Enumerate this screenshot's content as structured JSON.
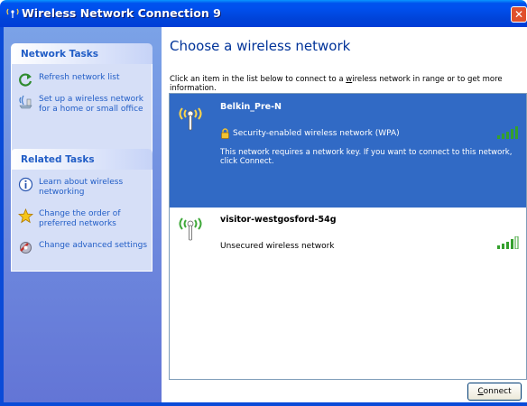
{
  "window": {
    "title": "Wireless Network Connection 9",
    "close_glyph": "✕"
  },
  "sidebar": {
    "network_tasks": {
      "title": "Network Tasks",
      "items": [
        {
          "label": "Refresh network list",
          "icon": "refresh-icon"
        },
        {
          "label": "Set up a wireless network for a home or small office",
          "icon": "setup-wireless-icon"
        }
      ]
    },
    "related_tasks": {
      "title": "Related Tasks",
      "items": [
        {
          "label": "Learn about wireless networking",
          "icon": "info-icon"
        },
        {
          "label": "Change the order of preferred networks",
          "icon": "star-icon"
        },
        {
          "label": "Change advanced settings",
          "icon": "settings-icon"
        }
      ]
    }
  },
  "main": {
    "heading": "Choose a wireless network",
    "instructions": {
      "before": "Click an item in the list below to connect to a ",
      "underlined_char": "w",
      "after": "ireless network in range or to get more information."
    },
    "networks": [
      {
        "name": "Belkin_Pre-N",
        "security": "Security-enabled wireless network (WPA)",
        "description": "This network requires a network key. If you want to connect to this network, click Connect.",
        "selected": true,
        "signal_bars": 5
      },
      {
        "name": "visitor-westgosford-54g",
        "security": "Unsecured wireless network",
        "selected": false,
        "signal_bars": 4
      }
    ],
    "connect_button": {
      "underlined_char": "C",
      "rest": "onnect"
    }
  },
  "colors": {
    "titlebar": "#0050ee",
    "sidebar": "#6f8fe0",
    "panel_text": "#215dc6",
    "selection": "#316ac5",
    "signal": "#34a02c"
  }
}
